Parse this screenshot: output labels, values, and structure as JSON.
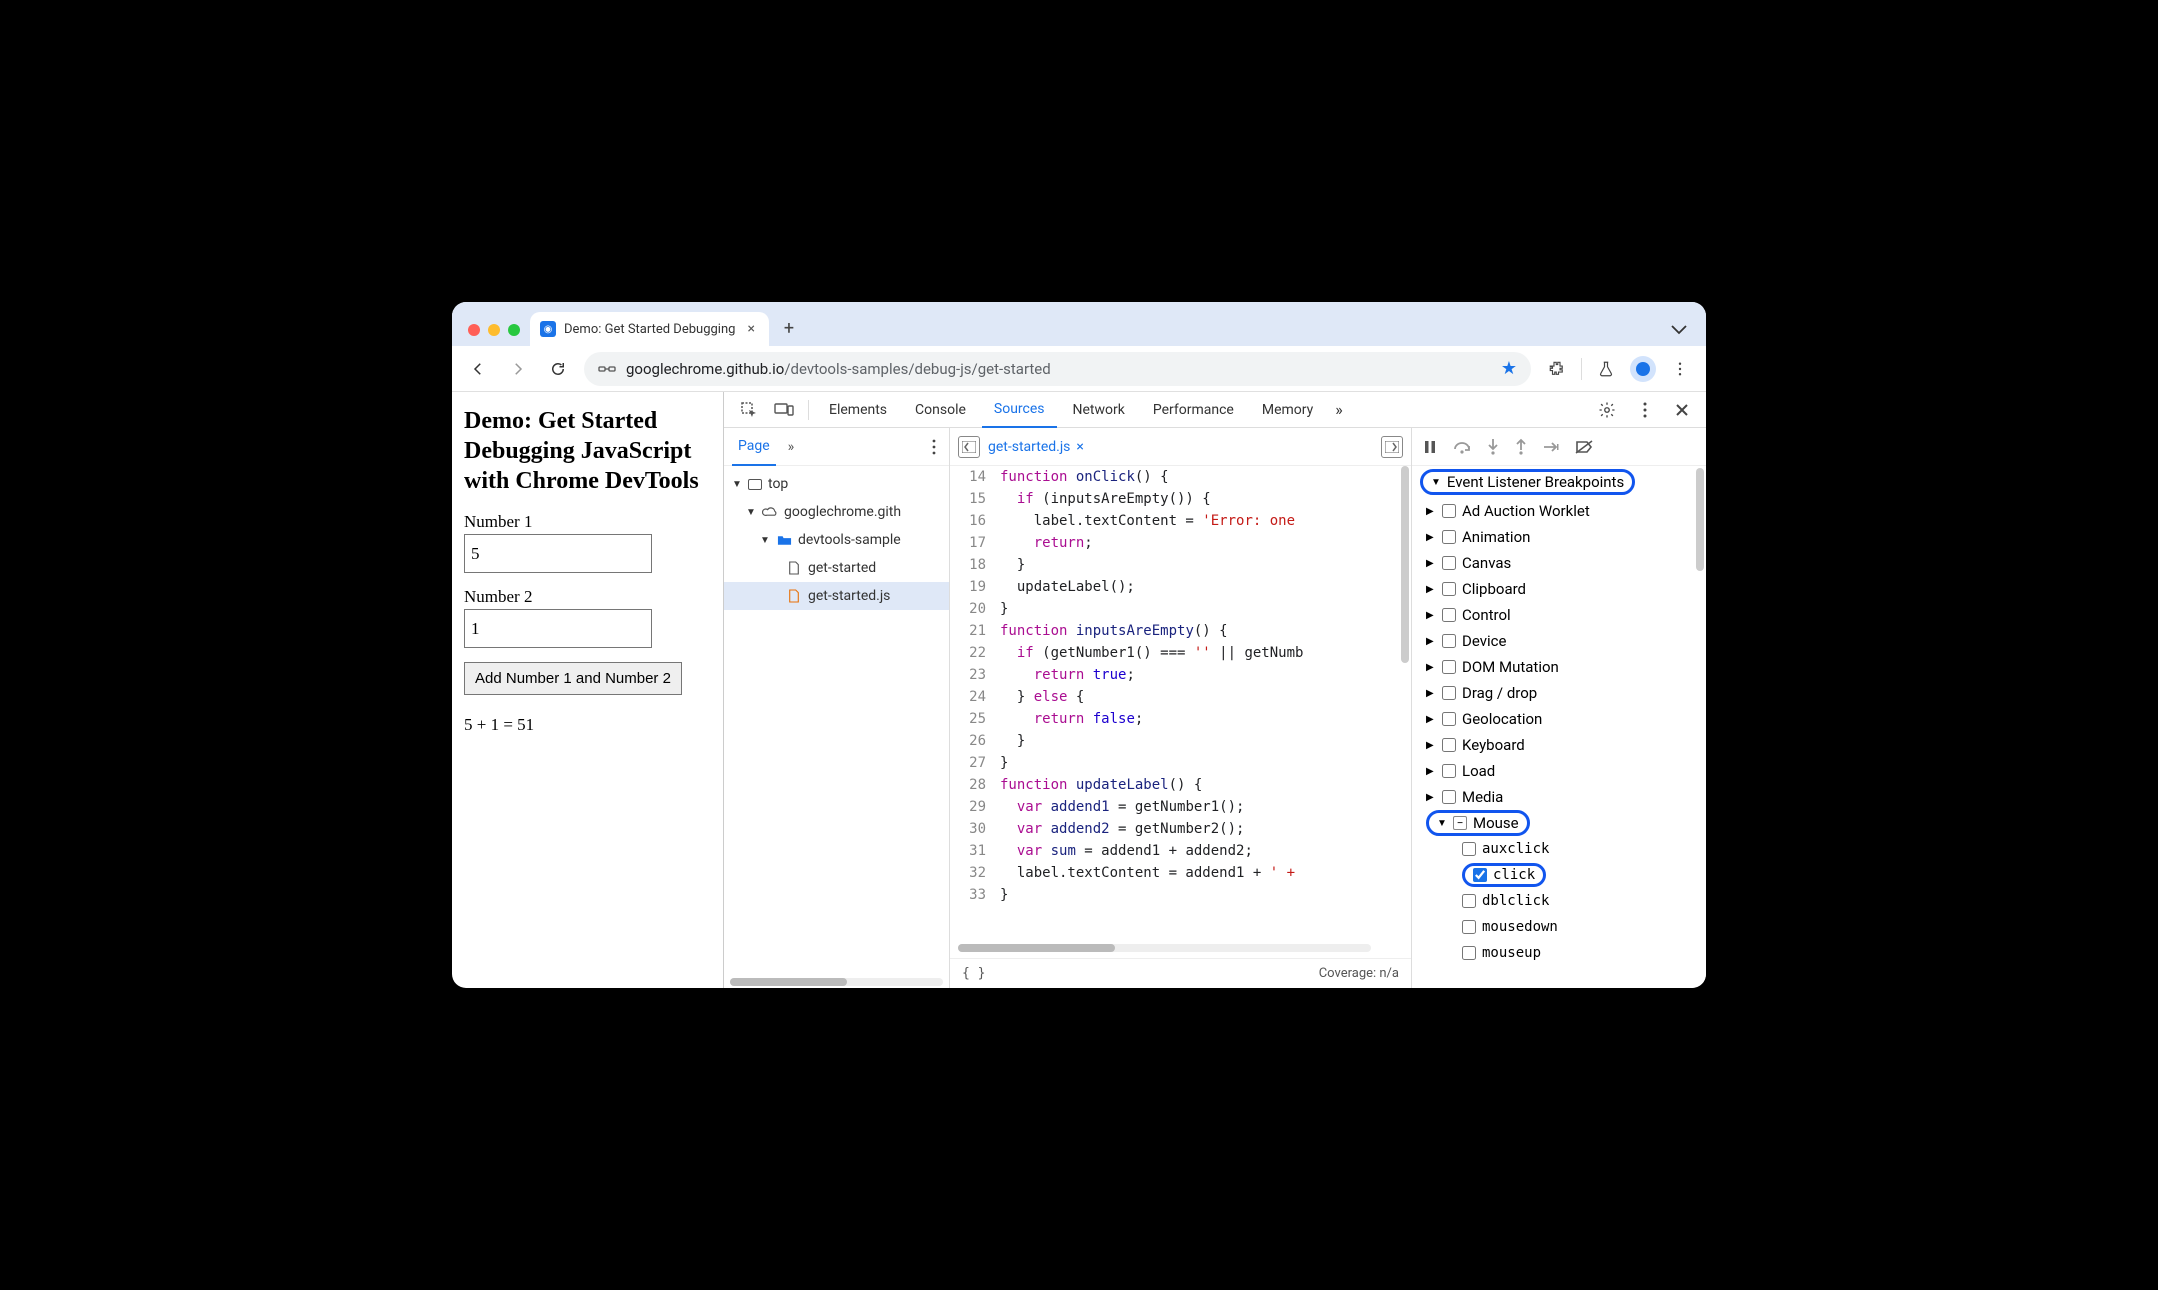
{
  "tab": {
    "title": "Demo: Get Started Debugging"
  },
  "url": {
    "host": "googlechrome.github.io",
    "path": "/devtools-samples/debug-js/get-started"
  },
  "page": {
    "heading": "Demo: Get Started Debugging JavaScript with Chrome DevTools",
    "label1": "Number 1",
    "value1": "5",
    "label2": "Number 2",
    "value2": "1",
    "button": "Add Number 1 and Number 2",
    "result": "5 + 1 = 51"
  },
  "devtools_tabs": [
    "Elements",
    "Console",
    "Sources",
    "Network",
    "Performance",
    "Memory"
  ],
  "devtools_active": "Sources",
  "filenav": {
    "page_tab": "Page",
    "tree": {
      "top": "top",
      "domain": "googlechrome.gith",
      "folder": "devtools-sample",
      "file_html": "get-started",
      "file_js": "get-started.js"
    }
  },
  "editor": {
    "filename": "get-started.js",
    "coverage": "Coverage: n/a",
    "first_line": 14,
    "lines": [
      [
        [
          "kw",
          "function"
        ],
        [
          "",
          ""
        ],
        [
          "fn",
          " onClick"
        ],
        [
          "",
          "() {"
        ]
      ],
      [
        [
          "",
          "  "
        ],
        [
          "kw",
          "if"
        ],
        [
          "",
          " (inputsAreEmpty()) {"
        ]
      ],
      [
        [
          "",
          "    label.textContent = "
        ],
        [
          "str",
          "'Error: one"
        ]
      ],
      [
        [
          "",
          "    "
        ],
        [
          "kw",
          "return"
        ],
        [
          "",
          ";"
        ]
      ],
      [
        [
          "",
          "  }"
        ]
      ],
      [
        [
          "",
          "  updateLabel();"
        ]
      ],
      [
        [
          "",
          "}"
        ]
      ],
      [
        [
          "kw",
          "function"
        ],
        [
          "fn",
          " inputsAreEmpty"
        ],
        [
          "",
          "() {"
        ]
      ],
      [
        [
          "",
          "  "
        ],
        [
          "kw",
          "if"
        ],
        [
          "",
          " (getNumber1() === "
        ],
        [
          "str",
          "''"
        ],
        [
          "",
          " || getNumb"
        ]
      ],
      [
        [
          "",
          "    "
        ],
        [
          "kw",
          "return"
        ],
        [
          "lit",
          " true"
        ],
        [
          "",
          ";"
        ]
      ],
      [
        [
          "",
          "  } "
        ],
        [
          "kw",
          "else"
        ],
        [
          "",
          " {"
        ]
      ],
      [
        [
          "",
          "    "
        ],
        [
          "kw",
          "return"
        ],
        [
          "lit",
          " false"
        ],
        [
          "",
          ";"
        ]
      ],
      [
        [
          "",
          "  }"
        ]
      ],
      [
        [
          "",
          "}"
        ]
      ],
      [
        [
          "kw",
          "function"
        ],
        [
          "fn",
          " updateLabel"
        ],
        [
          "",
          "() {"
        ]
      ],
      [
        [
          "",
          "  "
        ],
        [
          "kw",
          "var"
        ],
        [
          "fn",
          " addend1"
        ],
        [
          "",
          " = getNumber1();"
        ]
      ],
      [
        [
          "",
          "  "
        ],
        [
          "kw",
          "var"
        ],
        [
          "fn",
          " addend2"
        ],
        [
          "",
          " = getNumber2();"
        ]
      ],
      [
        [
          "",
          "  "
        ],
        [
          "kw",
          "var"
        ],
        [
          "fn",
          " sum"
        ],
        [
          "",
          " = addend1 + addend2;"
        ]
      ],
      [
        [
          "",
          "  label.textContent = addend1 + "
        ],
        [
          "str",
          "' +"
        ]
      ],
      [
        [
          "",
          "}"
        ]
      ]
    ]
  },
  "breakpoints": {
    "title": "Event Listener Breakpoints",
    "categories": [
      "Ad Auction Worklet",
      "Animation",
      "Canvas",
      "Clipboard",
      "Control",
      "Device",
      "DOM Mutation",
      "Drag / drop",
      "Geolocation",
      "Keyboard",
      "Load",
      "Media"
    ],
    "mouse": {
      "label": "Mouse",
      "events": [
        "auxclick",
        "click",
        "dblclick",
        "mousedown",
        "mouseup"
      ],
      "checked": "click"
    }
  }
}
